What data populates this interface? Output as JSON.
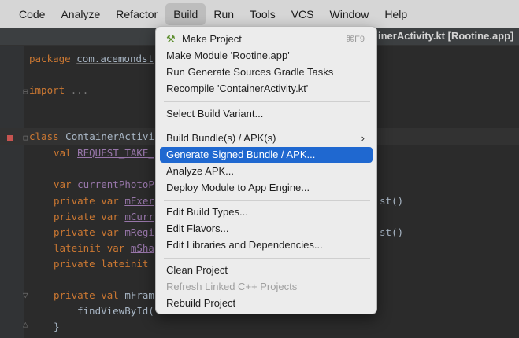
{
  "menubar": {
    "items": [
      "Code",
      "Analyze",
      "Refactor",
      "Build",
      "Run",
      "Tools",
      "VCS",
      "Window",
      "Help"
    ],
    "active": "Build"
  },
  "title_fragment": "inerActivity.kt [Rootine.app]",
  "build_menu": {
    "make_project": "Make Project",
    "make_project_shortcut": "⌘F9",
    "make_module": "Make Module 'Rootine.app'",
    "run_gradle": "Run Generate Sources Gradle Tasks",
    "recompile": "Recompile 'ContainerActivity.kt'",
    "select_variant": "Select Build Variant...",
    "build_bundle": "Build Bundle(s) / APK(s)",
    "generate_signed": "Generate Signed Bundle / APK...",
    "analyze_apk": "Analyze APK...",
    "deploy_module": "Deploy Module to App Engine...",
    "edit_build_types": "Edit Build Types...",
    "edit_flavors": "Edit Flavors...",
    "edit_libraries": "Edit Libraries and Dependencies...",
    "clean_project": "Clean Project",
    "refresh_linked": "Refresh Linked C++ Projects",
    "rebuild_project": "Rebuild Project"
  },
  "code": {
    "l1_kw": "package",
    "l1_pkg": "com.acemondst",
    "l2_kw": "import",
    "l2_fold": "...",
    "l3_kw": "class",
    "l3_name": "ContainerActivi",
    "l4_kw": "val",
    "l4_prop": "REQUEST_TAKE_",
    "l5_kw": "var",
    "l5_prop": "currentPhotoP",
    "l6_kw": "private var",
    "l6_prop": "mExer",
    "l7_kw": "private var",
    "l7_prop": "mCurr",
    "l8_kw": "private var",
    "l8_prop": "mRegi",
    "l9_kw": "lateinit var",
    "l9_prop": "mSha",
    "l10_kw": "private lateinit",
    "l11_kw": "private val",
    "l11_rest": "mFram",
    "l12_text": "findViewById(",
    "l13_text": "}",
    "tail_a": "st()",
    "tail_b": "st()"
  }
}
